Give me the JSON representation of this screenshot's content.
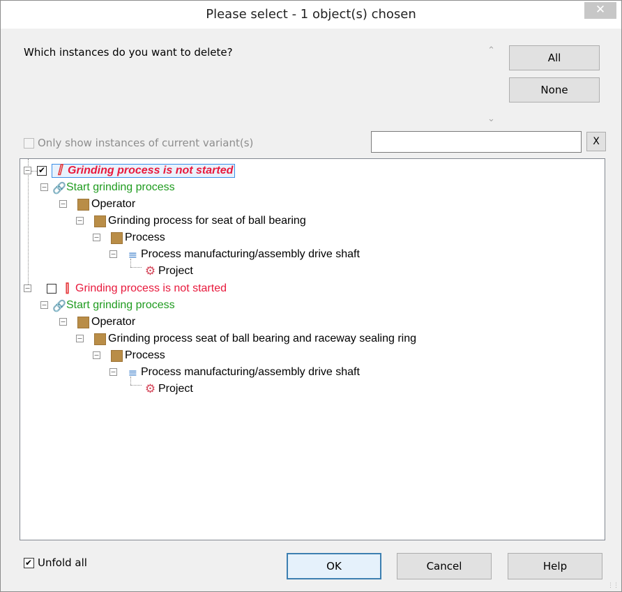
{
  "window": {
    "title": "Please select - 1 object(s) chosen",
    "close_label": "✕"
  },
  "question": "Which instances do you want to delete?",
  "buttons": {
    "all": "All",
    "none": "None",
    "clear": "X",
    "ok": "OK",
    "cancel": "Cancel",
    "help": "Help"
  },
  "variant_filter": {
    "label": "Only show instances of current variant(s)",
    "checked": false,
    "enabled": false
  },
  "filter_input": {
    "value": ""
  },
  "unfold_all": {
    "label": "Unfold all",
    "checked": true
  },
  "tree": {
    "group1": {
      "root": "Grinding process is not started",
      "checked": true,
      "step": "Start grinding process",
      "role": "Operator",
      "subprocess": "Grinding process for seat of ball bearing",
      "process": "Process",
      "structure": "Process manufacturing/assembly drive shaft",
      "project": "Project"
    },
    "group2": {
      "root": "Grinding process is not started",
      "checked": false,
      "step": "Start grinding process",
      "role": "Operator",
      "subprocess": "Grinding process seat of ball bearing and raceway sealing ring",
      "process": "Process",
      "structure": "Process manufacturing/assembly drive shaft",
      "project": "Project"
    }
  },
  "icons": {
    "event": "lightning-icon",
    "step": "link-icon",
    "role": "role-square-icon",
    "structure": "tree-structure-icon",
    "project": "gear-icon"
  },
  "colors": {
    "event_red": "#e8193c",
    "step_green": "#1f9b1f",
    "role_brown": "#b98d47",
    "selection_border": "#3a8ee6"
  }
}
